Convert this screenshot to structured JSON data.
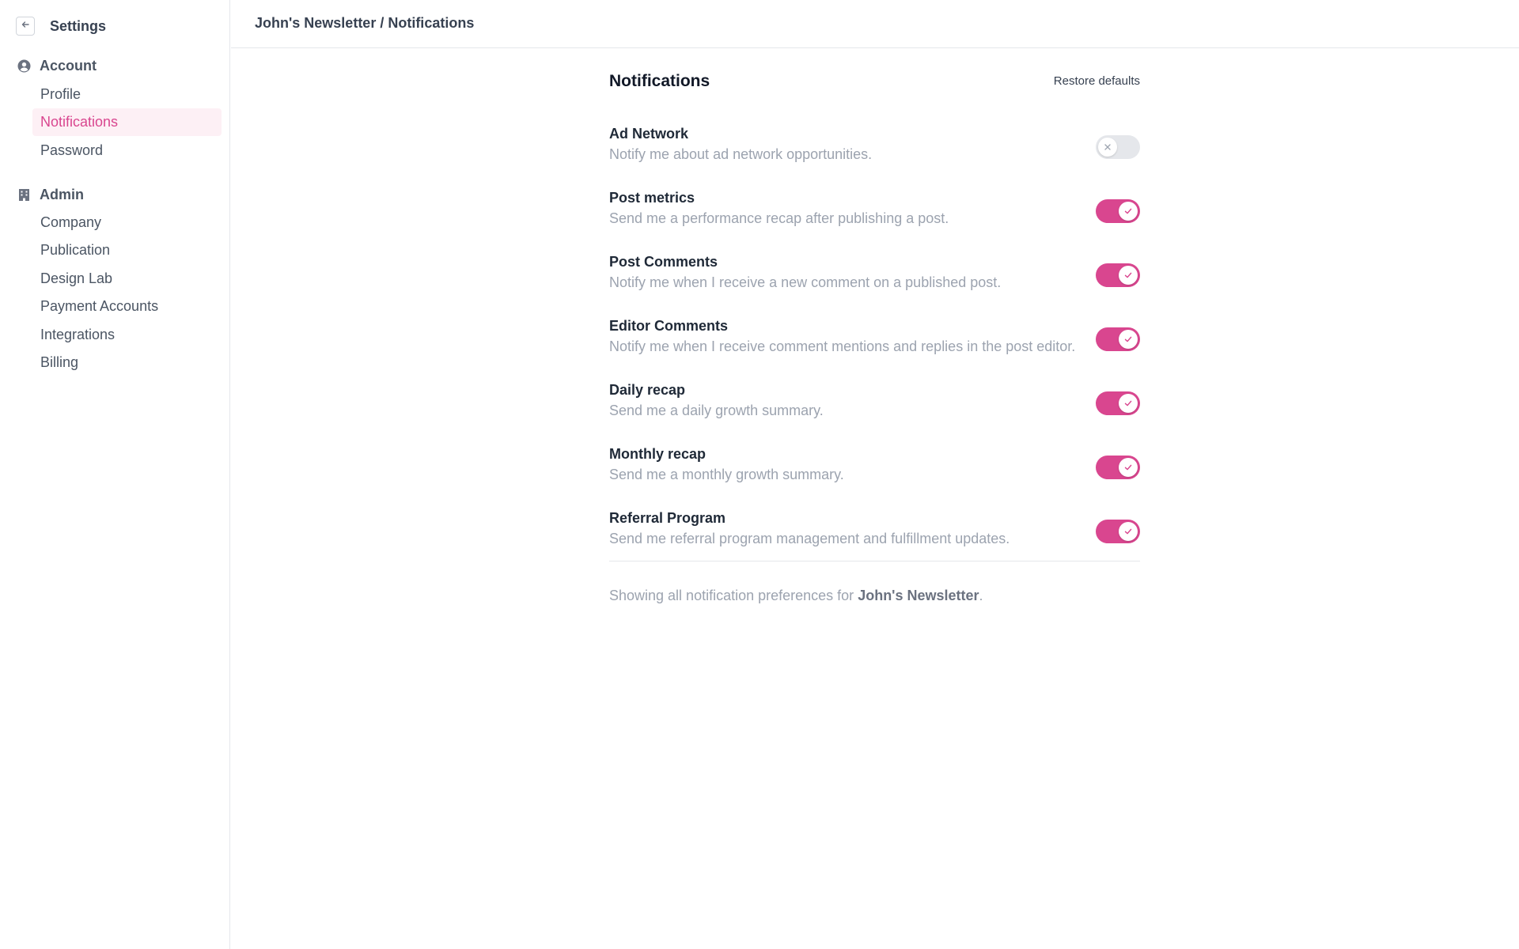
{
  "sidebar": {
    "title": "Settings",
    "back_icon": "arrow-left-icon",
    "groups": [
      {
        "label": "Account",
        "icon": "user-circle-icon",
        "items": [
          {
            "label": "Profile",
            "active": false
          },
          {
            "label": "Notifications",
            "active": true
          },
          {
            "label": "Password",
            "active": false
          }
        ]
      },
      {
        "label": "Admin",
        "icon": "building-icon",
        "items": [
          {
            "label": "Company",
            "active": false
          },
          {
            "label": "Publication",
            "active": false
          },
          {
            "label": "Design Lab",
            "active": false
          },
          {
            "label": "Payment Accounts",
            "active": false
          },
          {
            "label": "Integrations",
            "active": false
          },
          {
            "label": "Billing",
            "active": false
          }
        ]
      }
    ]
  },
  "header": {
    "breadcrumb": "John's Newsletter / Notifications"
  },
  "main": {
    "title": "Notifications",
    "restore_label": "Restore defaults",
    "preferences": [
      {
        "title": "Ad Network",
        "description": "Notify me about ad network opportunities.",
        "enabled": false
      },
      {
        "title": "Post metrics",
        "description": "Send me a performance recap after publishing a post.",
        "enabled": true
      },
      {
        "title": "Post Comments",
        "description": "Notify me when I receive a new comment on a published post.",
        "enabled": true
      },
      {
        "title": "Editor Comments",
        "description": "Notify me when I receive comment mentions and replies in the post editor.",
        "enabled": true
      },
      {
        "title": "Daily recap",
        "description": "Send me a daily growth summary.",
        "enabled": true
      },
      {
        "title": "Monthly recap",
        "description": "Send me a monthly growth summary.",
        "enabled": true
      },
      {
        "title": "Referral Program",
        "description": "Send me referral program management and fulfillment updates.",
        "enabled": true
      }
    ],
    "footer": {
      "prefix": "Showing all notification preferences for ",
      "publication": "John's Newsletter",
      "suffix": "."
    }
  },
  "colors": {
    "accent": "#d9468f",
    "accent_bg": "#fdf0f5",
    "toggle_off": "#e5e7eb",
    "muted_text": "#9ca3af"
  }
}
